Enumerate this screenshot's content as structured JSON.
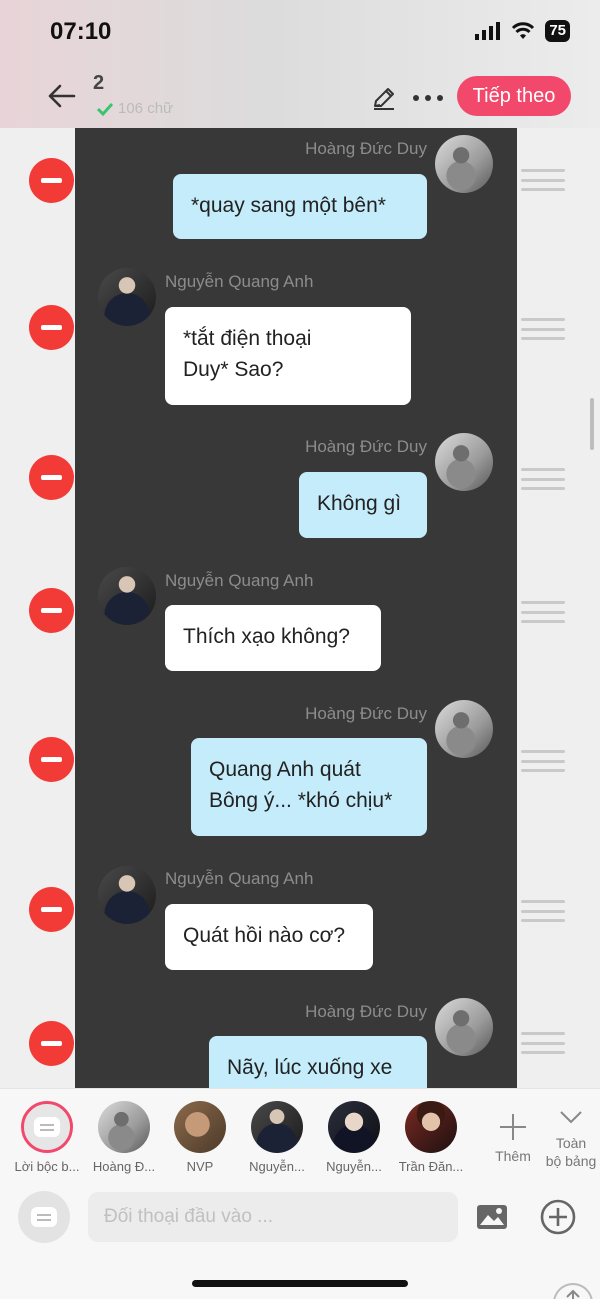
{
  "status": {
    "time": "07:10",
    "battery": "75"
  },
  "header": {
    "count": "2",
    "word_count": "106 chữ",
    "next_label": "Tiếp theo"
  },
  "messages": [
    {
      "speaker": "Hoàng Đức Duy",
      "side": "right",
      "lines": [
        "*quay sang một bên*"
      ]
    },
    {
      "speaker": "Nguyễn Quang Anh",
      "side": "left",
      "lines": [
        "*tắt điện thoại",
        "Duy* Sao?"
      ]
    },
    {
      "speaker": "Hoàng Đức Duy",
      "side": "right",
      "lines": [
        "Không gì"
      ]
    },
    {
      "speaker": "Nguyễn Quang Anh",
      "side": "left",
      "lines": [
        "Thích xạo không?"
      ]
    },
    {
      "speaker": "Hoàng Đức Duy",
      "side": "right",
      "lines": [
        "Quang Anh quát",
        "Bông ý... *khó chịu*"
      ]
    },
    {
      "speaker": "Nguyễn Quang Anh",
      "side": "left",
      "lines": [
        "Quát hồi nào cơ?"
      ]
    },
    {
      "speaker": "Hoàng Đức Duy",
      "side": "right",
      "lines": [
        "Nãy, lúc xuống xe"
      ]
    }
  ],
  "characters": [
    {
      "label": "Lời bộc b..."
    },
    {
      "label": "Hoàng Đ..."
    },
    {
      "label": "NVP"
    },
    {
      "label": "Nguyễn..."
    },
    {
      "label": "Nguyễn..."
    },
    {
      "label": "Trần Đăn..."
    }
  ],
  "toolbar": {
    "add_label": "Thêm",
    "full_board_line1": "Toàn",
    "full_board_line2": "bộ bảng"
  },
  "input": {
    "placeholder": "Đối thoại đầu vào ..."
  },
  "colors": {
    "accent": "#f2486b",
    "delete": "#f23a37",
    "bubble_right": "#c5ecfa",
    "chat_bg": "#383838"
  }
}
